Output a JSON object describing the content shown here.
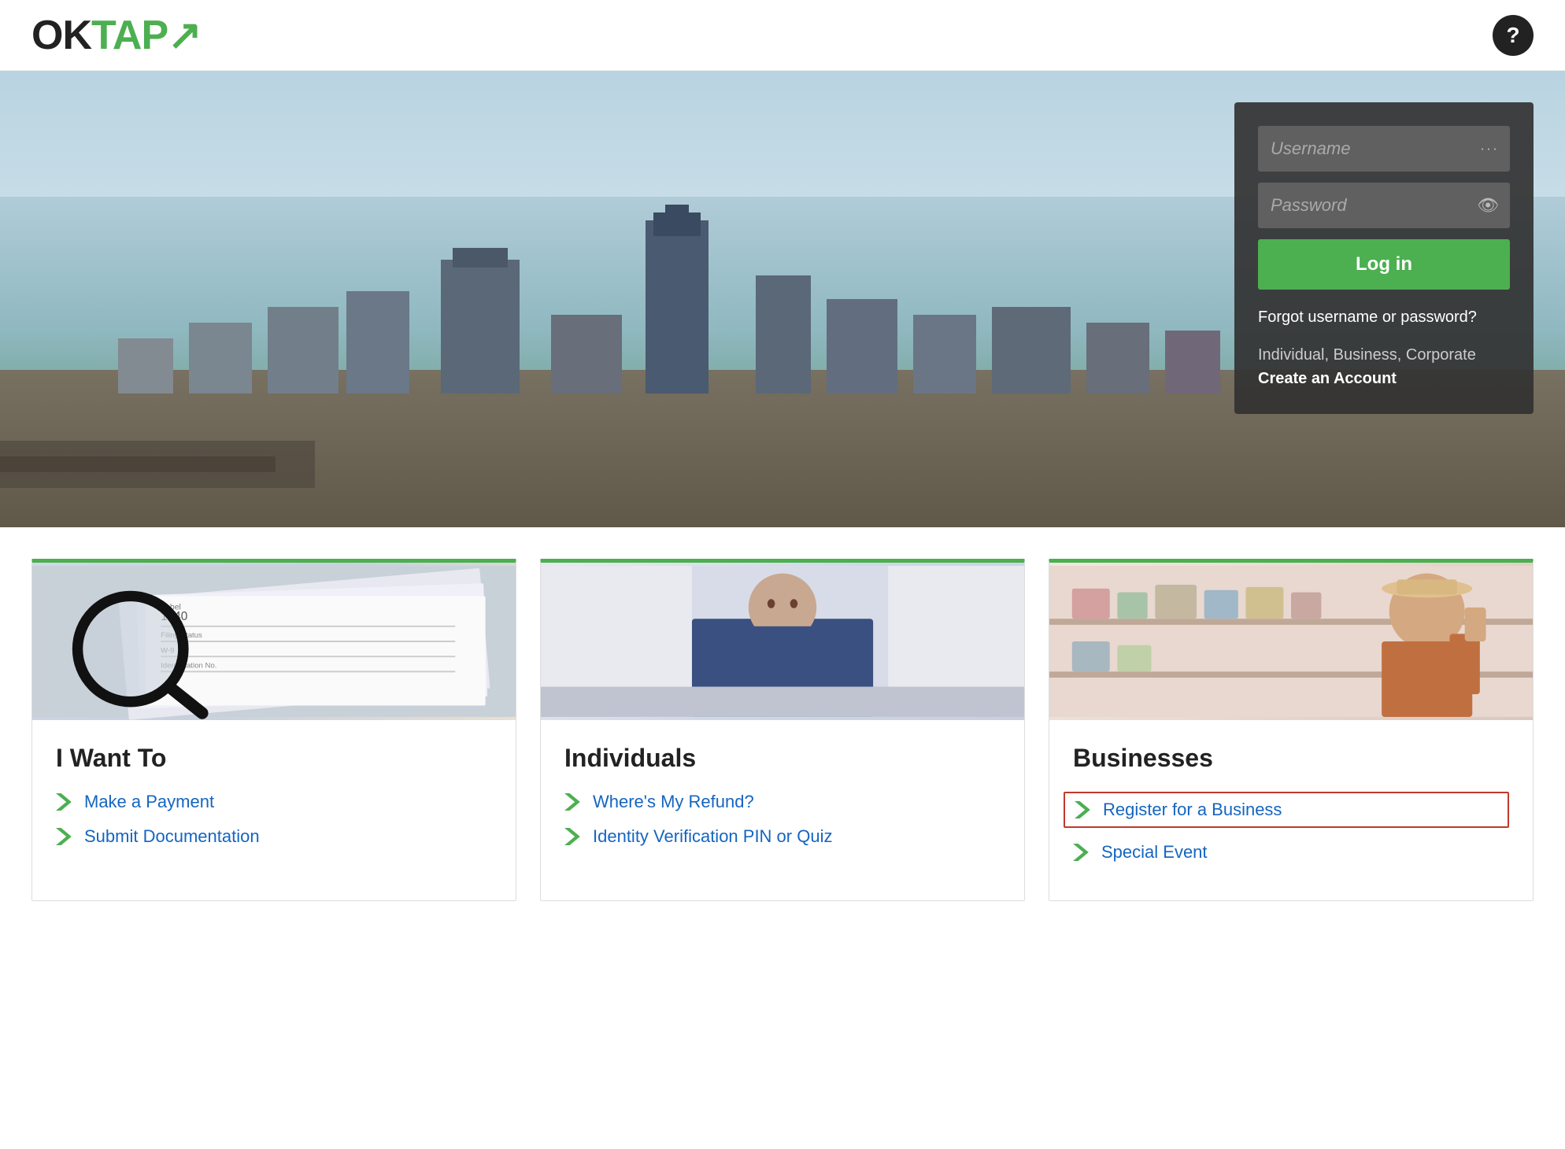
{
  "header": {
    "logo_ok": "OK",
    "logo_tap": "TAP",
    "logo_arrow": "↪",
    "help_label": "?"
  },
  "hero": {
    "login_panel": {
      "username_placeholder": "Username",
      "password_placeholder": "Password",
      "login_button": "Log in",
      "forgot_text": "Forgot username or password?",
      "create_account_pre": "Individual, Business, Corporate",
      "create_account_label": "Create an Account"
    }
  },
  "cards": [
    {
      "id": "i-want-to",
      "title": "I Want To",
      "links": [
        {
          "label": "Make a Payment",
          "highlighted": false
        },
        {
          "label": "Submit Documentation",
          "highlighted": false
        }
      ]
    },
    {
      "id": "individuals",
      "title": "Individuals",
      "links": [
        {
          "label": "Where's My Refund?",
          "highlighted": false
        },
        {
          "label": "Identity Verification PIN or Quiz",
          "highlighted": false
        }
      ]
    },
    {
      "id": "businesses",
      "title": "Businesses",
      "links": [
        {
          "label": "Register for a Business",
          "highlighted": true
        },
        {
          "label": "Special Event",
          "highlighted": false
        }
      ]
    }
  ]
}
